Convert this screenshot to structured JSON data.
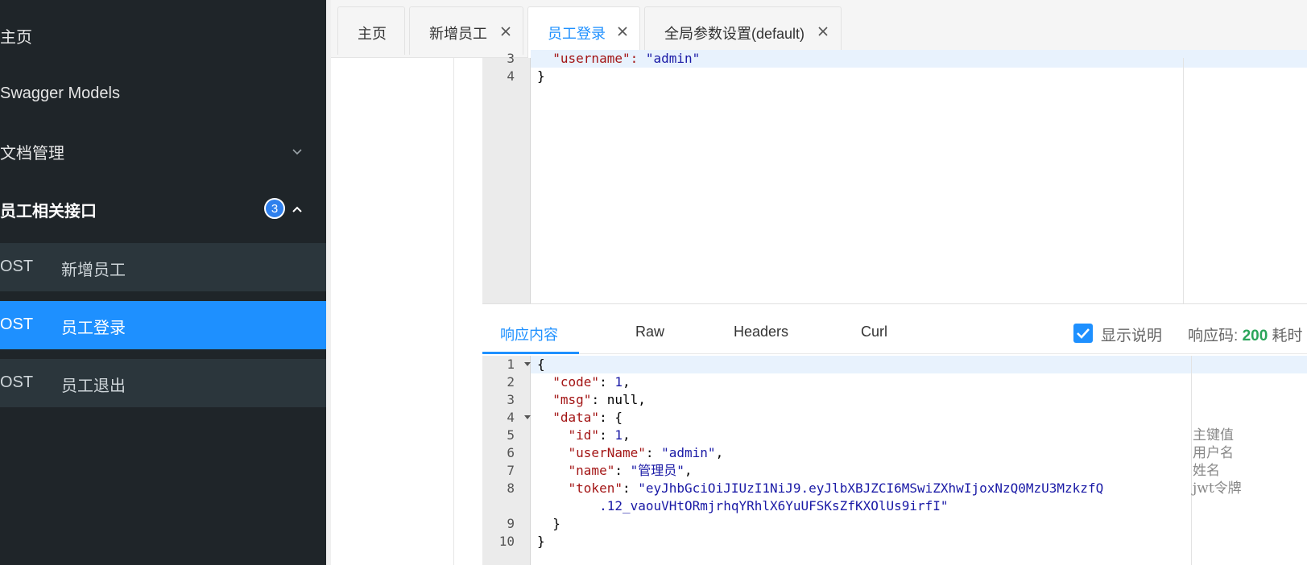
{
  "sidebar": {
    "items": [
      {
        "label": "主页"
      },
      {
        "label": "Swagger Models"
      },
      {
        "label": "文档管理"
      }
    ],
    "group": {
      "label": "员工相关接口",
      "badge": "3"
    },
    "sub_items": [
      {
        "method": "OST",
        "name": "新增员工"
      },
      {
        "method": "OST",
        "name": "员工登录"
      },
      {
        "method": "OST",
        "name": "员工退出"
      }
    ]
  },
  "tabs": [
    {
      "label": "主页"
    },
    {
      "label": "新增员工"
    },
    {
      "label": "员工登录"
    },
    {
      "label": "全局参数设置(default)"
    }
  ],
  "request_editor": {
    "lines": [
      {
        "n": "3",
        "text_key": "  \"username\": ",
        "text_str": "\"admin\""
      },
      {
        "n": "4",
        "text": "}"
      }
    ]
  },
  "response_tabs": {
    "items": [
      "响应内容",
      "Raw",
      "Headers",
      "Curl"
    ],
    "show_desc_label": "显示说明",
    "status_label": "响应码:",
    "status_code": "200",
    "time_label": "耗时"
  },
  "response_editor": {
    "line_numbers": [
      "1",
      "2",
      "3",
      "4",
      "5",
      "6",
      "7",
      "8",
      "",
      "9",
      "10"
    ],
    "lines": [
      "{",
      "  \"code\": 1,",
      "  \"msg\": null,",
      "  \"data\": {",
      "    \"id\": 1,",
      "    \"userName\": \"admin\",",
      "    \"name\": \"管理员\",",
      "    \"token\": \"eyJhbGciOiJIUzI1NiJ9.eyJlbXBJZCI6MSwiZXhwIjoxNzQ0MzU3MzkzfQ",
      "        .12_vaouVHtORmjrhqYRhlX6YuUFSKsZfKXOlUs9irfI\"",
      "  }",
      "}"
    ],
    "comments": [
      "主键值",
      "用户名",
      "姓名",
      "jwt令牌"
    ]
  }
}
